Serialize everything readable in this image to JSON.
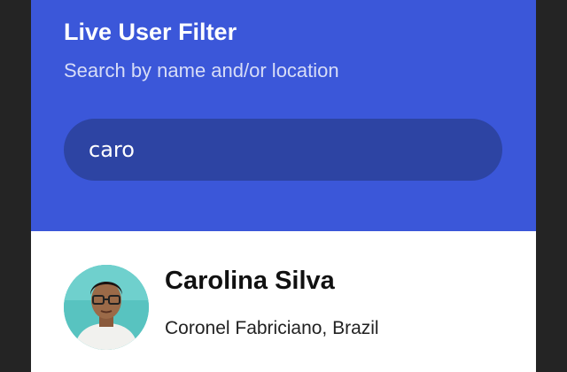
{
  "header": {
    "title": "Live User Filter",
    "subtitle": "Search by name and/or location"
  },
  "search": {
    "value": "caro"
  },
  "users": [
    {
      "name": "Carolina Silva",
      "location": "Coronel Fabriciano, Brazil",
      "avatar_icon": "user-photo"
    }
  ],
  "colors": {
    "header_bg": "#3b57d9",
    "search_bg": "#2d44a3",
    "page_bg": "#242424",
    "list_bg": "#ffffff"
  }
}
